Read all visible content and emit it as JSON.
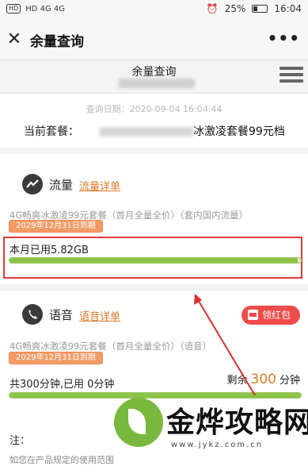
{
  "status_bar": {
    "left": "HD 4G 4G",
    "alarm": "⏰",
    "battery": "25%",
    "time": "16:04"
  },
  "app_bar": {
    "title": "余量查询",
    "more": "•••"
  },
  "page": {
    "title": "余量查询",
    "query_date": "查询日期：2020-09-04 16:04:44",
    "current_plan_label": "当前套餐：",
    "current_plan_name": "冰激凌套餐99元档"
  },
  "data_section": {
    "title": "流量",
    "detail_link": "流量详单",
    "package": "4G畅爽冰激凌99元套餐（首月全量全价）（套内国内流量）",
    "expiry": "2029年12月31日到期",
    "used": "本月已用5.82GB",
    "usage_fraction": 0.99
  },
  "voice_section": {
    "title": "语音",
    "detail_link": "语音详单",
    "red_packet": "领红包",
    "package": "4G畅爽冰激凌99元套餐（首月全量全价）（语音）",
    "expiry": "2029年12月31日到期",
    "summary": "共300分钟,已用 0分钟",
    "remain_label": "剩余",
    "remain_value": "300",
    "remain_unit": "分钟",
    "usage_fraction": 1.0
  },
  "note": {
    "title": "注：",
    "text": "如您在产品规定的使用范围"
  },
  "watermark": {
    "text": "金烨攻略网",
    "url": "www.jykz.com.cn"
  },
  "colors": {
    "accent": "#e07a2a",
    "bar_green": "#8bc34a",
    "highlight_red": "#e23b3b",
    "red_packet": "#ee4b4b"
  }
}
